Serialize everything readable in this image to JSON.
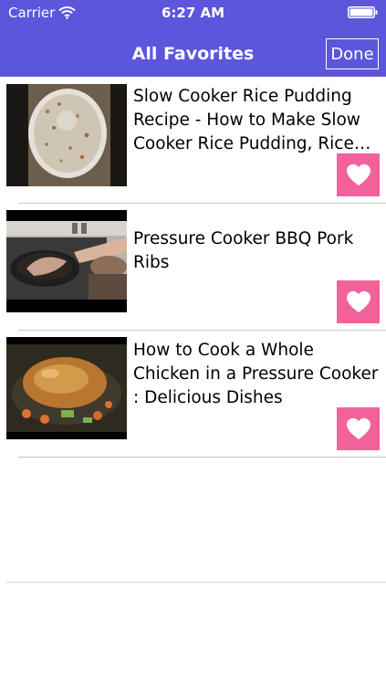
{
  "status_bar": {
    "carrier": "Carrier",
    "time": "6:27 AM",
    "wifi_icon": "wifi-icon",
    "battery_icon": "battery-icon"
  },
  "nav": {
    "title": "All Favorites",
    "done_label": "Done"
  },
  "colors": {
    "nav_background": "#5b56dc",
    "favorite_button": "#f2629a",
    "separator": "#c8c7cc"
  },
  "favorites": [
    {
      "title": "Slow Cooker Rice Pudding Recipe - How to Make Slow Cooker Rice Pudding, Rice Pud...",
      "thumbnail": "rice-pudding-thumbnail",
      "favorite_icon": "heart-icon"
    },
    {
      "title": "Pressure Cooker BBQ Pork Ribs",
      "thumbnail": "pork-ribs-thumbnail",
      "favorite_icon": "heart-icon"
    },
    {
      "title": "How to Cook a Whole Chicken in a Pressure Cooker : Delicious Dishes",
      "thumbnail": "whole-chicken-thumbnail",
      "favorite_icon": "heart-icon"
    }
  ]
}
